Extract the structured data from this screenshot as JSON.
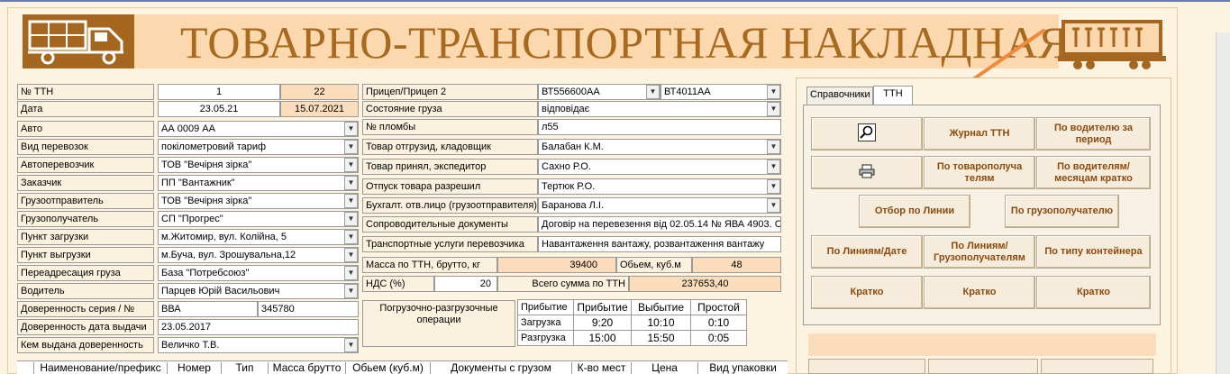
{
  "title": "ТОВАРНО-ТРАНСПОРТНАЯ НАКЛАДНАЯ",
  "colors": {
    "accent": "#a76a1e",
    "banner": "#fbd8ad",
    "button_text": "#8b4a0d",
    "arrow": "#f08a3c"
  },
  "icons": {
    "truck": "truck-icon",
    "wagon": "container-wagon-icon",
    "arrow": "arrow-annotation-icon",
    "search": "magnifier-icon",
    "print": "printer-icon",
    "dropdown": "chevron-down-icon"
  },
  "left_form": {
    "ttn_label": "№ ТТН",
    "ttn_value": "1",
    "ttn_value2": "22",
    "date_label": "Дата",
    "date_value": "23.05.21",
    "date_value2": "15.07.2021",
    "auto_label": "Авто",
    "auto_value": "АА 0009 АА",
    "transport_type_label": "Вид перевозок",
    "transport_type_value": "покілометровий тариф",
    "carrier_label": "Автоперевозчик",
    "carrier_value": "ТОВ \"Вечірня зірка\"",
    "customer_label": "Заказчик",
    "customer_value": "ПП \"Вантажник\"",
    "shipper_label": "Грузоотправитель",
    "shipper_value": "ТОВ \"Вечірня зірка\"",
    "consignee_label": "Грузополучатель",
    "consignee_value": "СП \"Прогрес\"",
    "load_point_label": "Пункт загрузки",
    "load_point_value": "м.Житомир, вул. Колійна, 5",
    "unload_point_label": "Пункт выгрузки",
    "unload_point_value": "м.Буча, вул. Зрошувальна,12",
    "readdress_label": "Переадресация груза",
    "readdress_value": "База \"Потребсоюз\"",
    "driver_label": "Водитель",
    "driver_value": "Парцев Юрій Васильович",
    "poa_series_label": "Доверенность серия / №",
    "poa_series_value": "ВВА",
    "poa_number_value": "345780",
    "poa_date_label": "Доверенность дата выдачи",
    "poa_date_value": "23.05.2017",
    "poa_issuer_label": "Кем выдана доверенность",
    "poa_issuer_value": "Величко Т.В."
  },
  "mid_form": {
    "trailer_label": "Прицеп/Прицеп 2",
    "trailer_value": "ВТ556600АА",
    "trailer2_value": "ВТ4011АА",
    "cargo_state_label": "Состояние груза",
    "cargo_state_value": "відповідає",
    "seal_label": "№ пломбы",
    "seal_value": "л55",
    "released_by_label": "Товар отгрузид, кладовщик",
    "released_by_value": "Балабан К.М.",
    "received_by_label": "Товар принял, экспедитор",
    "received_by_value": "Сахно Р.О.",
    "permitted_by_label": "Отпуск товара разрешил",
    "permitted_by_value": "Тертюк Р.О.",
    "accountant_label": "Бухгалт. отв.лицо (грузоотправителя)",
    "accountant_value": "Баранова Л.І.",
    "docs_label": "Сопроводительные документы",
    "docs_value": "Договір на перевезення від 02.05.14 № ЯВА 4903. С",
    "services_label": "Транспортные услуги перевозчика",
    "services_value": "Навантаження вантажу, розвантаження вантажу",
    "mass_label": "Масса по ТТН, брутто, кг",
    "mass_value": "39400",
    "volume_label": "Обьем, куб.м",
    "volume_value": "48",
    "vat_label": "НДС (%)",
    "vat_value": "20",
    "total_label": "Всего сумма по ТТН",
    "total_value": "237653,40",
    "ops_label": "Погрузочно-разгрузочные операции"
  },
  "timing": {
    "headers": [
      "Прибытие",
      "Прибытие",
      "Выбытие",
      "Простой"
    ],
    "rows": [
      {
        "label": "Загрузка",
        "arrive": "9:20",
        "depart": "10:10",
        "idle": "0:10"
      },
      {
        "label": "Разгрузка",
        "arrive": "15:00",
        "depart": "15:50",
        "idle": "0:05"
      }
    ]
  },
  "tabs": [
    {
      "label": "Справочники",
      "active": false
    },
    {
      "label": "ТТН",
      "active": true
    }
  ],
  "buttons": {
    "journal": "Журнал ТТН",
    "by_driver_period": "По водителю за период",
    "by_consignees": "По товарополуча телям",
    "by_drivers_months": "По водителям/ месяцам кратко",
    "by_line": "Отбор по Линии",
    "by_consignee": "По грузополучателю",
    "lines_date": "По Линиям/Дате",
    "lines_consignees": "По Линиям/ Грузополучателям",
    "container_type": "По типу контейнера",
    "brief1": "Кратко",
    "brief2": "Кратко",
    "brief3": "Кратко"
  },
  "grid": {
    "columns": [
      "Наименование/префикс",
      "Номер",
      "Тип",
      "Масса брутто",
      "Обьем (куб.м)",
      "Документы с грузом",
      "К-во мест",
      "Цена",
      "Вид упаковки"
    ]
  }
}
